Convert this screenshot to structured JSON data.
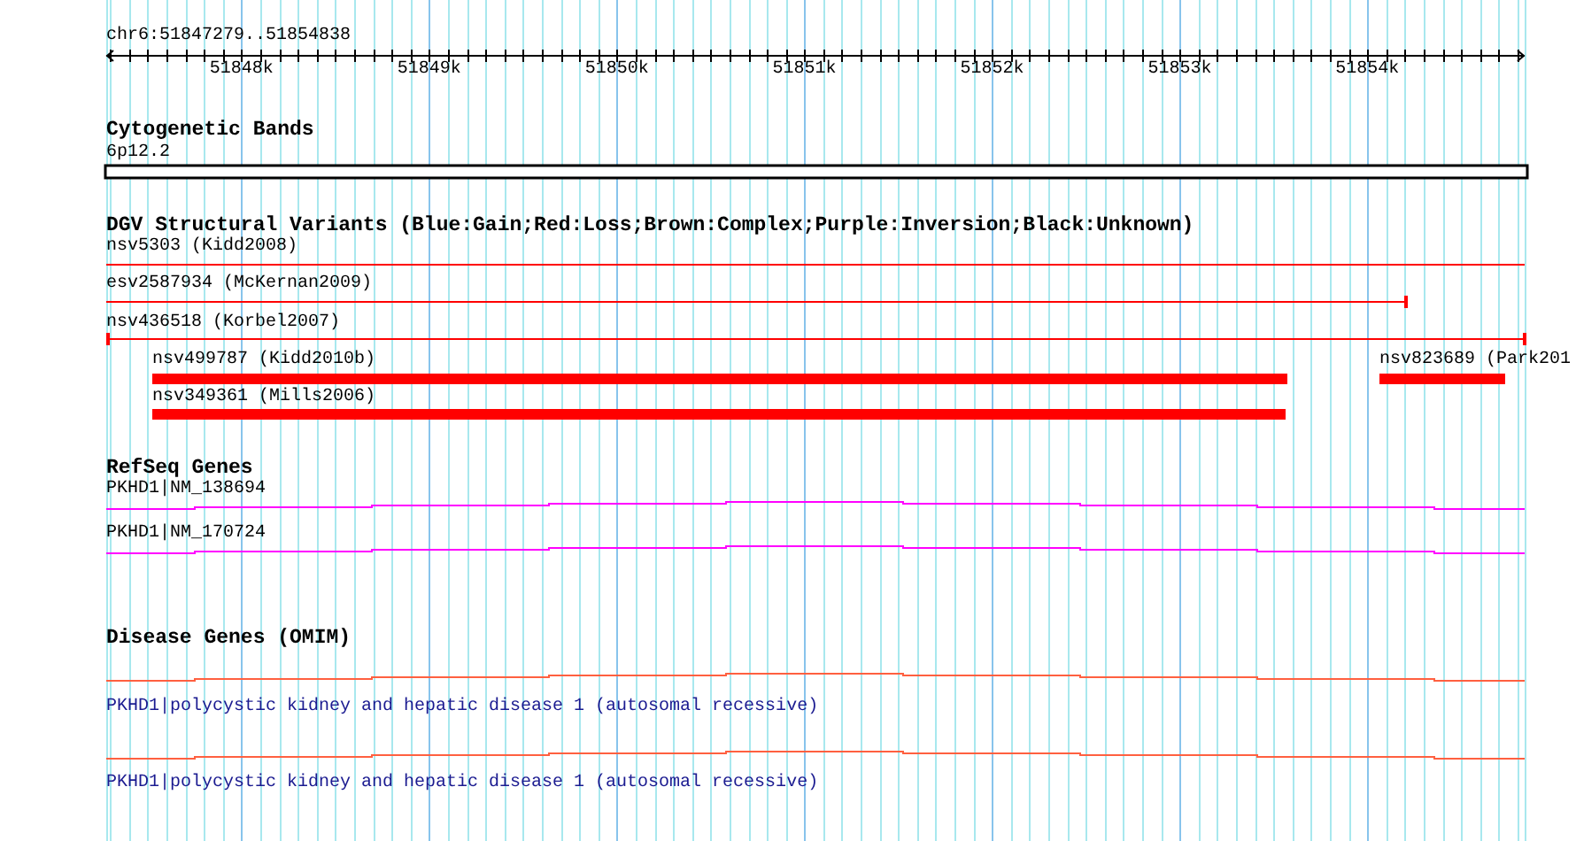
{
  "ruler": {
    "region": "chr6:51847279..51854838",
    "ticks": [
      "51848k",
      "51849k",
      "51850k",
      "51851k",
      "51852k",
      "51853k",
      "51854k"
    ]
  },
  "tracks": [
    {
      "kind": "bands",
      "title": "Cytogenetic Bands",
      "features": [
        {
          "label": "6p12.2"
        }
      ]
    },
    {
      "kind": "variants",
      "title": "DGV Structural Variants (Blue:Gain;Red:Loss;Brown:Complex;Purple:Inversion;Black:Unknown)",
      "features": [
        {
          "label": "nsv5303 (Kidd2008)",
          "color": "#ff0000"
        },
        {
          "label": "esv2587934 (McKernan2009)",
          "color": "#ff0000"
        },
        {
          "label": "nsv436518 (Korbel2007)",
          "color": "#ff0000"
        },
        {
          "label": "nsv499787 (Kidd2010b)",
          "color": "#ff0000"
        },
        {
          "label": "nsv823689 (Park201",
          "color": "#ff0000"
        },
        {
          "label": "nsv349361 (Mills2006)",
          "color": "#ff0000"
        }
      ]
    },
    {
      "kind": "genes",
      "title": "RefSeq Genes",
      "features": [
        {
          "label": "PKHD1|NM_138694"
        },
        {
          "label": "PKHD1|NM_170724"
        }
      ]
    },
    {
      "kind": "disease",
      "title": "Disease Genes (OMIM)",
      "features": [
        {
          "label": "PKHD1|polycystic kidney and hepatic disease 1 (autosomal recessive)"
        },
        {
          "label": "PKHD1|polycystic kidney and hepatic disease 1 (autosomal recessive)"
        }
      ]
    }
  ]
}
